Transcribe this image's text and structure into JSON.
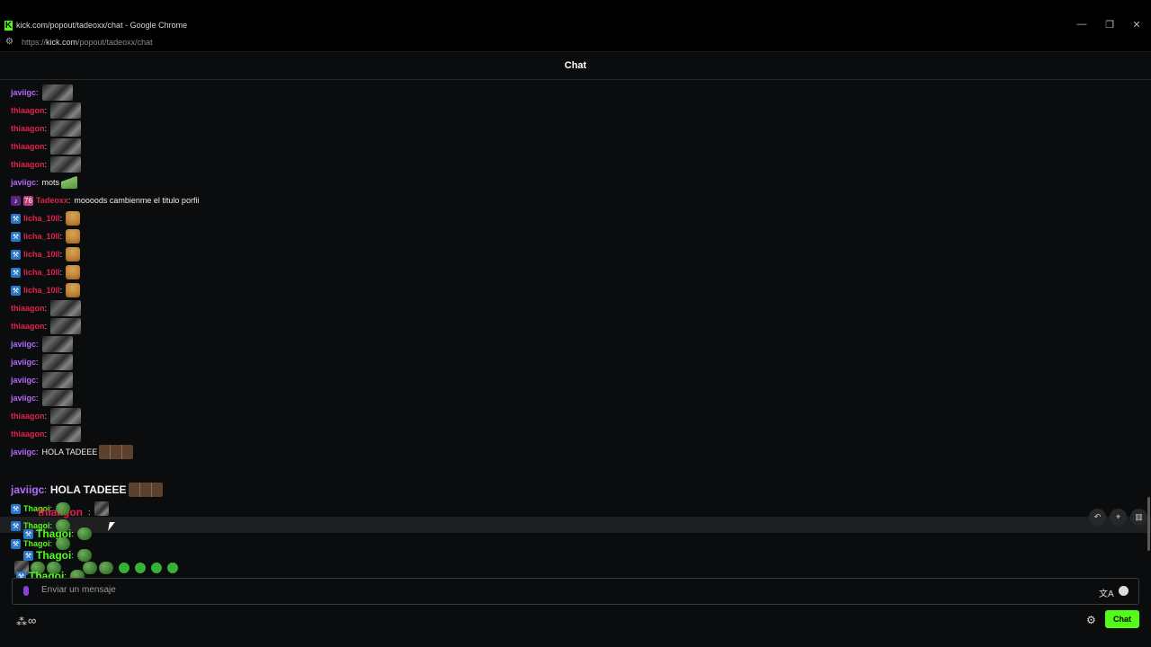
{
  "window": {
    "title": "kick.com/popout/tadeoxx/chat - Google Chrome",
    "url_prefix": "https://",
    "url_domain": "kick.com",
    "url_path": "/popout/tadeoxx/chat",
    "controls": [
      "—",
      "❐",
      "✕"
    ]
  },
  "header": {
    "title": "Chat"
  },
  "colors": {
    "accent": "#53fc18",
    "purple": "#b36bff",
    "red": "#e0234a",
    "blue": "#3a8bea",
    "green": "#53fc18"
  },
  "messages": [
    {
      "user": "javiigc",
      "color": "#b36bff",
      "emote": "meme"
    },
    {
      "user": "thiaagon",
      "color": "#e0234a",
      "emote": "meme"
    },
    {
      "user": "thiaagon",
      "color": "#e0234a",
      "emote": "meme"
    },
    {
      "user": "thiaagon",
      "color": "#e0234a",
      "emote": "meme"
    },
    {
      "user": "thiaagon",
      "color": "#e0234a",
      "emote": "meme"
    },
    {
      "user": "javiigc",
      "color": "#b36bff",
      "text": "mots"
    },
    {
      "user": "Tadeoxx",
      "color": "#e0234a",
      "text": "moooods cambienme el titulo porfii"
    },
    {
      "user": "licha_10ll",
      "color": "#e0234a",
      "emote": "cat"
    },
    {
      "user": "licha_10ll",
      "color": "#e0234a",
      "emote": "cat"
    },
    {
      "user": "licha_10ll",
      "color": "#e0234a",
      "emote": "cat"
    },
    {
      "user": "licha_10ll",
      "color": "#e0234a",
      "emote": "cat"
    },
    {
      "user": "licha_10ll",
      "color": "#e0234a",
      "emote": "cat"
    },
    {
      "user": "thiaagon",
      "color": "#e0234a",
      "emote": "meme"
    },
    {
      "user": "thiaagon",
      "color": "#e0234a",
      "emote": "meme"
    },
    {
      "user": "javiigc",
      "color": "#b36bff",
      "emote": "meme"
    },
    {
      "user": "javiigc",
      "color": "#b36bff",
      "emote": "meme"
    },
    {
      "user": "javiigc",
      "color": "#b36bff",
      "emote": "meme"
    },
    {
      "user": "javiigc",
      "color": "#b36bff",
      "emote": "meme"
    },
    {
      "user": "thiaagon",
      "color": "#e0234a",
      "emote": "meme"
    },
    {
      "user": "thiaagon",
      "color": "#e0234a",
      "emote": "meme"
    },
    {
      "user": "javiigc",
      "color": "#b36bff",
      "text": "HOLA TADEEE"
    }
  ],
  "overlay": {
    "big_user": "javiigc",
    "big_text": "HOLA TADEEE",
    "thagoi_user": "Thagoi",
    "thiaagon_user": "thiaagon"
  },
  "input": {
    "placeholder": "Enviar un mensaje"
  },
  "footer": {
    "chat_button": "Chat",
    "infinity": "∞"
  },
  "hover_actions": [
    "reply-icon",
    "pin-icon",
    "delete-icon"
  ]
}
